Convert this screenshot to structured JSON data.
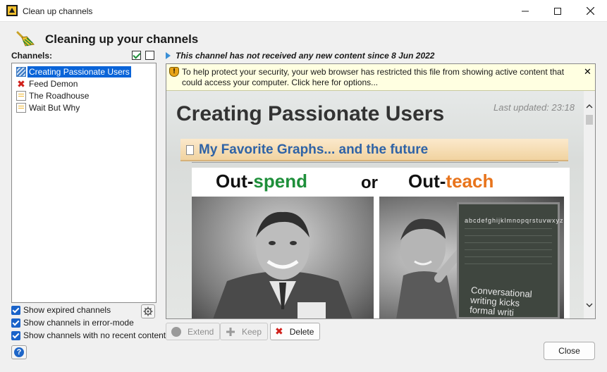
{
  "window": {
    "title": "Clean up channels"
  },
  "header": {
    "title": "Cleaning up your channels"
  },
  "channels": {
    "label": "Channels:",
    "items": [
      {
        "label": "Creating Passionate Users",
        "icon": "striped-feed-icon",
        "selected": true
      },
      {
        "label": "Feed Demon",
        "icon": "error-x-icon",
        "selected": false
      },
      {
        "label": "The Roadhouse",
        "icon": "feed-page-icon",
        "selected": false
      },
      {
        "label": "Wait But Why",
        "icon": "feed-page-icon",
        "selected": false
      }
    ]
  },
  "options": [
    {
      "label": "Show expired channels",
      "checked": true
    },
    {
      "label": "Show channels in error-mode",
      "checked": true
    },
    {
      "label": "Show channels with no recent content",
      "checked": true
    }
  ],
  "status": {
    "text": "This channel has not received any new content since 8 Jun 2022"
  },
  "infobar": {
    "text": "To help protect your security, your web browser has restricted this file from showing active content that could access your computer. Click here for options..."
  },
  "web": {
    "title": "Creating Passionate Users",
    "updated": "Last updated: 23:18",
    "post_title": "My Favorite Graphs... and the future",
    "caption_left_prefix": "Out-",
    "caption_left_word": "spend",
    "caption_or": "or",
    "caption_right_prefix": "Out-",
    "caption_right_word": "teach",
    "board_alphabet": "abcdefghijklmnopqrstuvwxyz",
    "board_text": "Conversational\nwriting kicks\nformal writi"
  },
  "actions": {
    "extend": "Extend",
    "keep": "Keep",
    "delete": "Delete",
    "close": "Close"
  },
  "colors": {
    "selection": "#0a64d8",
    "accent_green": "#1e8f3a",
    "accent_orange": "#e8741c",
    "link_blue": "#2f63a6"
  }
}
